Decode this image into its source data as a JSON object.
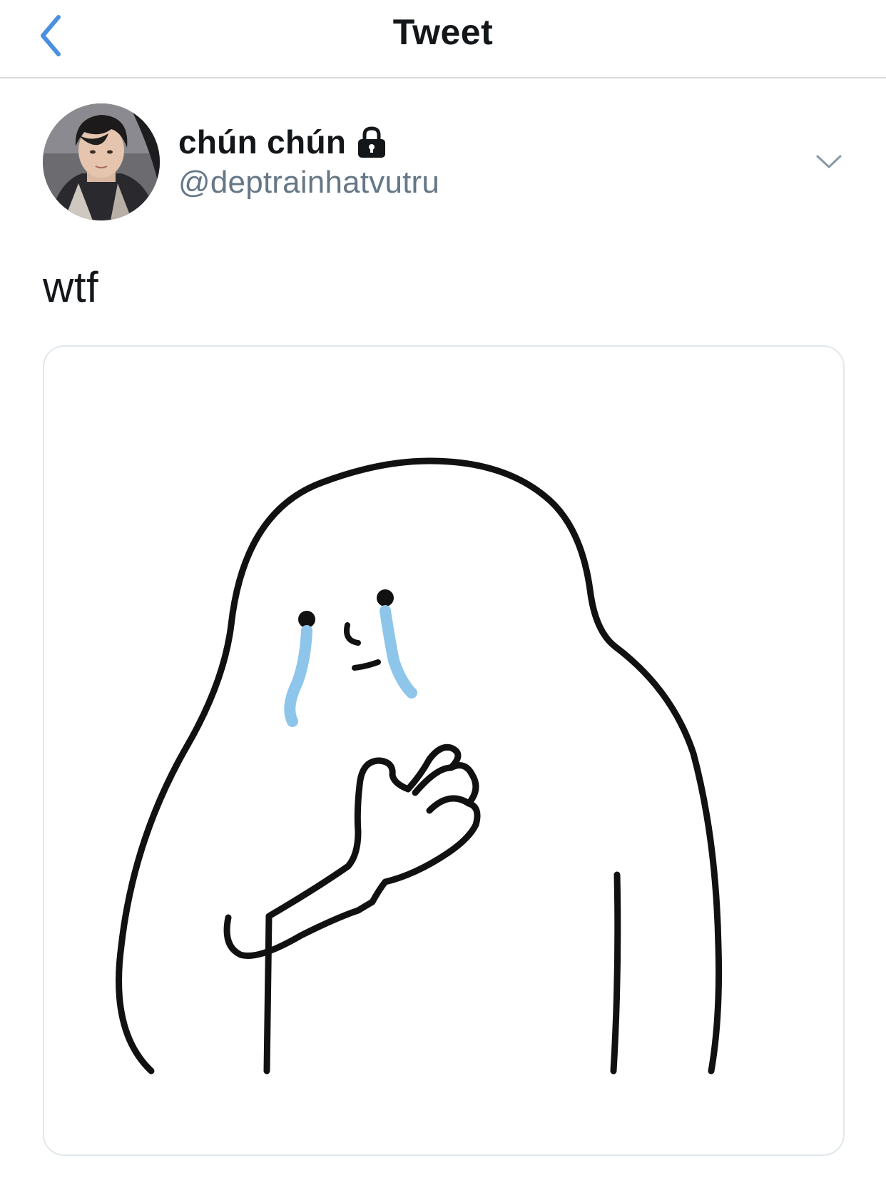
{
  "nav": {
    "title": "Tweet",
    "back_icon": "chevron-left-icon",
    "accent_color": "#4a90e2"
  },
  "tweet": {
    "author": {
      "display_name": "chún chún",
      "handle": "@deptrainhatvutru",
      "protected_icon": "lock-icon"
    },
    "more_icon": "chevron-down-icon",
    "text": "wtf",
    "media": {
      "icon": "crying-ghost-sticker",
      "tear_color": "#8ec5ea"
    }
  },
  "colors": {
    "text_primary": "#14171a",
    "text_secondary": "#657786",
    "divider": "#d7dbde",
    "card_border": "#e1e8ed"
  }
}
